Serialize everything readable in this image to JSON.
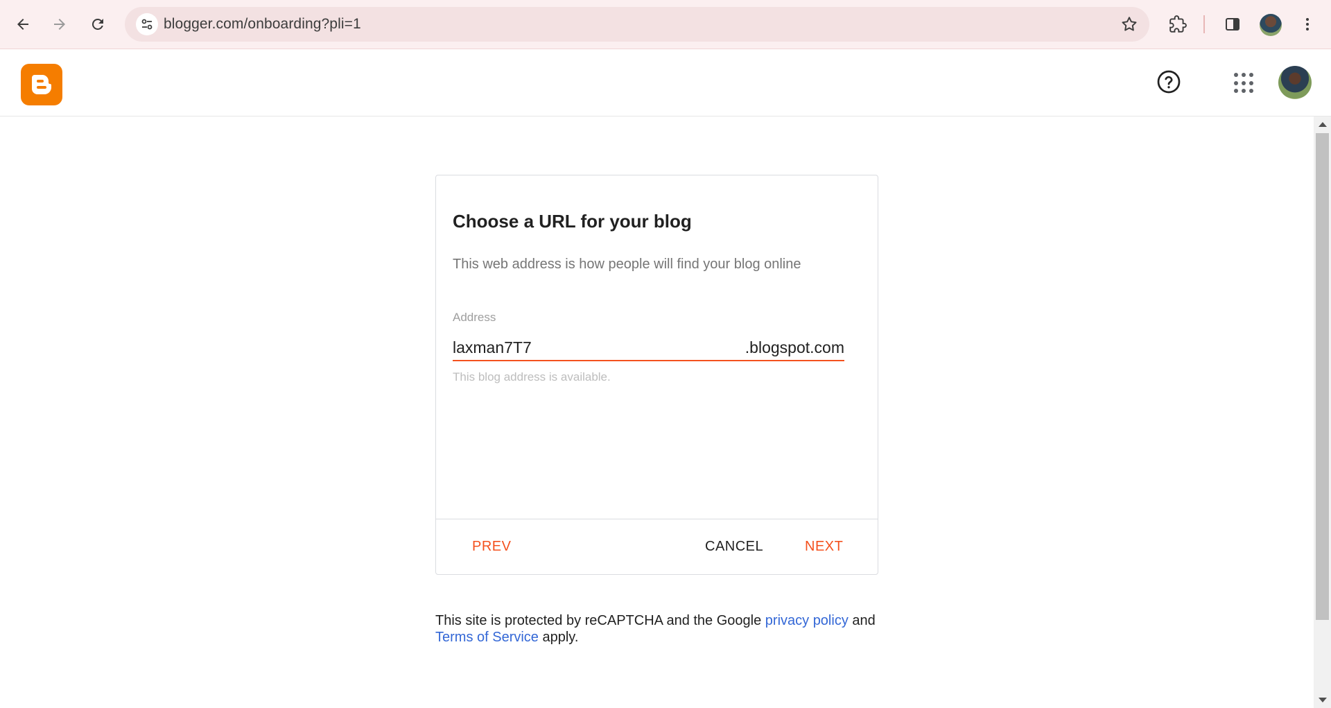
{
  "browser": {
    "url": "blogger.com/onboarding?pli=1",
    "icons": [
      "back-arrow-icon",
      "forward-arrow-icon",
      "reload-icon",
      "site-settings-icon",
      "star-icon",
      "extensions-icon",
      "side-panel-icon",
      "profile-avatar",
      "kebab-menu-icon"
    ]
  },
  "header": {
    "logo": "blogger-logo",
    "help_icon": "help-icon",
    "apps_icon": "apps-grid-icon",
    "avatar": "account-avatar"
  },
  "dialog": {
    "title": "Choose a URL for your blog",
    "description": "This web address is how people will find your blog online",
    "field_label": "Address",
    "field_value": "laxman7T7",
    "field_suffix": ".blogspot.com",
    "helper_text": "This blog address is available.",
    "buttons": {
      "prev": "PREV",
      "cancel": "CANCEL",
      "next": "NEXT"
    }
  },
  "notice": {
    "part1": "This site is protected by reCAPTCHA and the Google ",
    "privacy_link": "privacy policy",
    "part2": " and",
    "terms_link": "Terms of Service",
    "part3": " apply."
  },
  "colors": {
    "accent": "#f4511e",
    "blogger_orange": "#f57d00",
    "link": "#3367d6"
  }
}
